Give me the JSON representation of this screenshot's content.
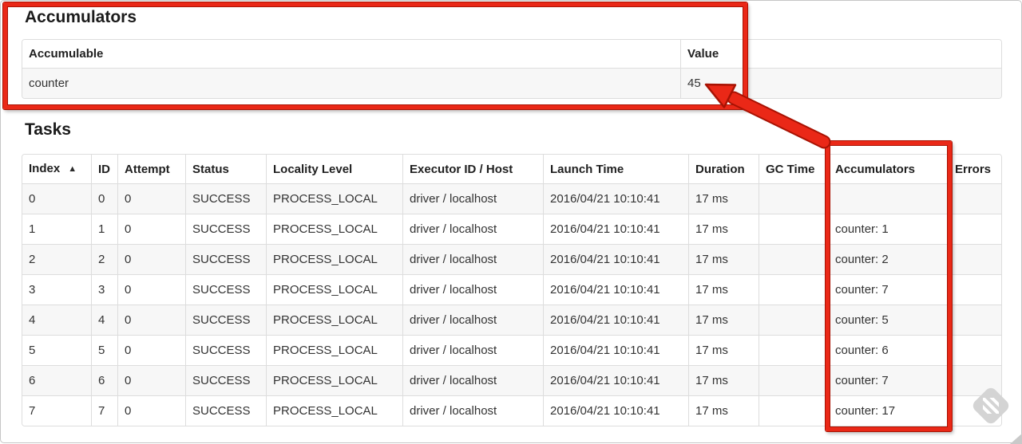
{
  "theme": {
    "annotation_red": "#ea2817",
    "annotation_red_dark": "#a81203",
    "table_border": "#dddddd",
    "stripe_bg": "#f7f7f7",
    "text_color": "#333333"
  },
  "accumulators_section": {
    "title": "Accumulators",
    "table": {
      "headers": [
        {
          "label": "Accumulable"
        },
        {
          "label": "Value"
        }
      ],
      "rows": [
        [
          "counter",
          "45"
        ]
      ]
    }
  },
  "tasks_section": {
    "title": "Tasks",
    "table": {
      "headers": [
        {
          "label": "Index",
          "sort": "▲"
        },
        {
          "label": "ID"
        },
        {
          "label": "Attempt"
        },
        {
          "label": "Status"
        },
        {
          "label": "Locality Level"
        },
        {
          "label": "Executor ID / Host"
        },
        {
          "label": "Launch Time"
        },
        {
          "label": "Duration"
        },
        {
          "label": "GC Time"
        },
        {
          "label": "Accumulators"
        },
        {
          "label": "Errors"
        }
      ],
      "rows": [
        [
          "0",
          "0",
          "0",
          "SUCCESS",
          "PROCESS_LOCAL",
          "driver / localhost",
          "2016/04/21 10:10:41",
          "17 ms",
          "",
          "",
          ""
        ],
        [
          "1",
          "1",
          "0",
          "SUCCESS",
          "PROCESS_LOCAL",
          "driver / localhost",
          "2016/04/21 10:10:41",
          "17 ms",
          "",
          "counter: 1",
          ""
        ],
        [
          "2",
          "2",
          "0",
          "SUCCESS",
          "PROCESS_LOCAL",
          "driver / localhost",
          "2016/04/21 10:10:41",
          "17 ms",
          "",
          "counter: 2",
          ""
        ],
        [
          "3",
          "3",
          "0",
          "SUCCESS",
          "PROCESS_LOCAL",
          "driver / localhost",
          "2016/04/21 10:10:41",
          "17 ms",
          "",
          "counter: 7",
          ""
        ],
        [
          "4",
          "4",
          "0",
          "SUCCESS",
          "PROCESS_LOCAL",
          "driver / localhost",
          "2016/04/21 10:10:41",
          "17 ms",
          "",
          "counter: 5",
          ""
        ],
        [
          "5",
          "5",
          "0",
          "SUCCESS",
          "PROCESS_LOCAL",
          "driver / localhost",
          "2016/04/21 10:10:41",
          "17 ms",
          "",
          "counter: 6",
          ""
        ],
        [
          "6",
          "6",
          "0",
          "SUCCESS",
          "PROCESS_LOCAL",
          "driver / localhost",
          "2016/04/21 10:10:41",
          "17 ms",
          "",
          "counter: 7",
          ""
        ],
        [
          "7",
          "7",
          "0",
          "SUCCESS",
          "PROCESS_LOCAL",
          "driver / localhost",
          "2016/04/21 10:10:41",
          "17 ms",
          "",
          "counter: 17",
          ""
        ]
      ]
    }
  },
  "annotations": {
    "accumulators_box": "highlight around accumulators summary",
    "column_box": "highlight around tasks accumulators column",
    "arrow": "arrow from accumulators column to total value 45"
  }
}
